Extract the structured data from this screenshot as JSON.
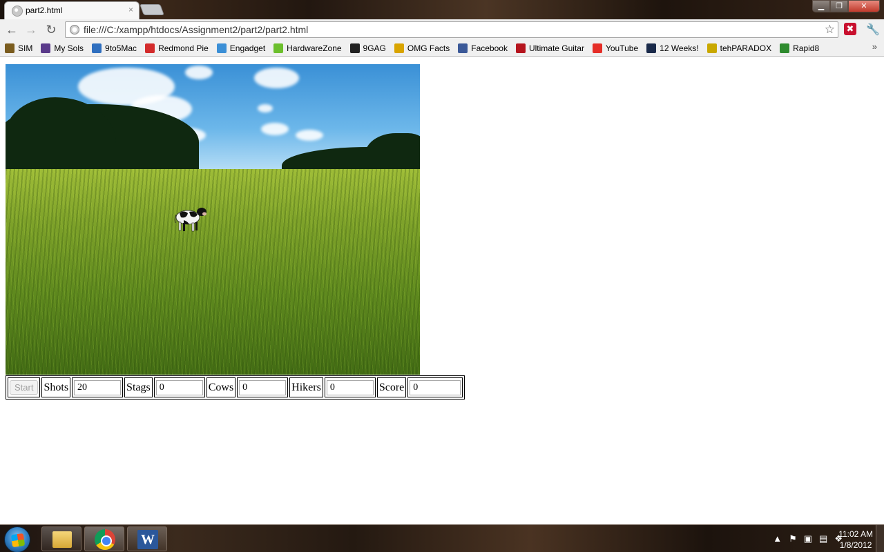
{
  "browser": {
    "tab_title": "part2.html",
    "tab_close": "×",
    "url": "file:///C:/xampp/htdocs/Assignment2/part2/part2.html",
    "window_buttons": {
      "minimize": "▁",
      "maximize": "❐",
      "close": "✕"
    },
    "nav": {
      "back": "←",
      "forward": "→",
      "reload": "↻"
    },
    "bookmark_star": "☆",
    "extension_icon": "✖",
    "wrench": "🔧",
    "bookmarks": [
      {
        "label": "SIM",
        "icon_color": "#7a5c1e"
      },
      {
        "label": "My Sols",
        "icon_color": "#5a3a8a"
      },
      {
        "label": "9to5Mac",
        "icon_color": "#2f6fbf"
      },
      {
        "label": "Redmond Pie",
        "icon_color": "#d32b2b"
      },
      {
        "label": "Engadget",
        "icon_color": "#3b8fd6"
      },
      {
        "label": "HardwareZone",
        "icon_color": "#6cbf2c"
      },
      {
        "label": "9GAG",
        "icon_color": "#222222"
      },
      {
        "label": "OMG Facts",
        "icon_color": "#d9a400"
      },
      {
        "label": "Facebook",
        "icon_color": "#3b5998"
      },
      {
        "label": "Ultimate Guitar",
        "icon_color": "#b5141d"
      },
      {
        "label": "YouTube",
        "icon_color": "#e52d27"
      },
      {
        "label": "12 Weeks!",
        "icon_color": "#1a2a4a"
      },
      {
        "label": "tehPARADOX",
        "icon_color": "#c9a800"
      },
      {
        "label": "Rapid8",
        "icon_color": "#2e8b2e"
      }
    ],
    "bookmarks_overflow": "»"
  },
  "game": {
    "start_label": "Start",
    "shots_label": "Shots",
    "shots_value": "20",
    "stags_label": "Stags",
    "stags_value": "0",
    "cows_label": "Cows",
    "cows_value": "0",
    "hikers_label": "Hikers",
    "hikers_value": "0",
    "score_label": "Score",
    "score_value": "0"
  },
  "taskbar": {
    "word_glyph": "W",
    "tray_icons": [
      "▲",
      "⚑",
      "▣",
      "▤",
      "❖"
    ],
    "time": "11:02 AM",
    "date": "1/8/2012"
  }
}
